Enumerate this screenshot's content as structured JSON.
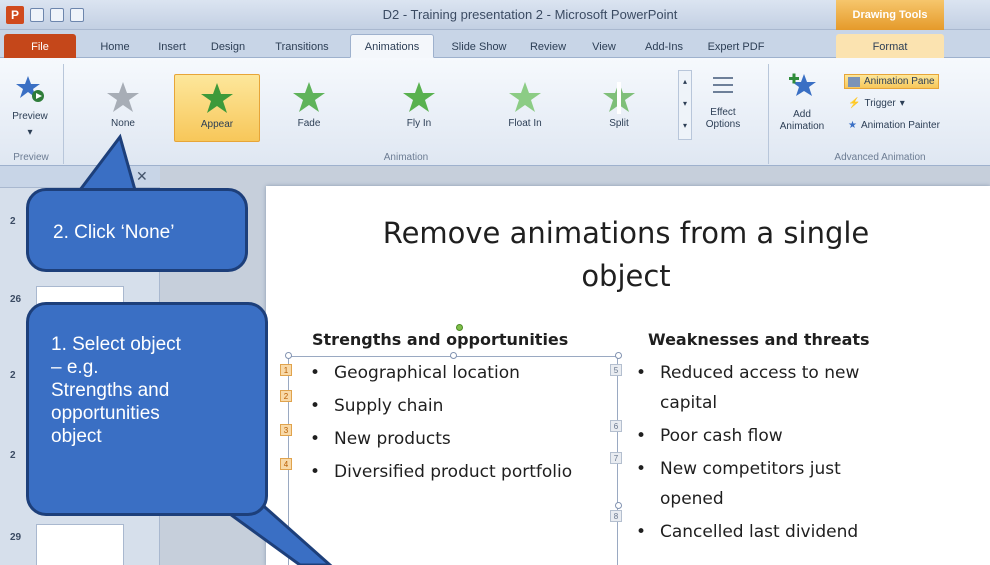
{
  "window": {
    "title": "D2 - Training presentation 2 - Microsoft PowerPoint",
    "contextual_tab": "Drawing Tools"
  },
  "tabs": [
    "File",
    "Home",
    "Insert",
    "Design",
    "Transitions",
    "Animations",
    "Slide Show",
    "Review",
    "View",
    "Add-Ins",
    "Expert PDF",
    "Format"
  ],
  "ribbon": {
    "preview": {
      "label": "Preview",
      "group": "Preview"
    },
    "animation_group": "Animation",
    "gallery": [
      "None",
      "Appear",
      "Fade",
      "Fly In",
      "Float In",
      "Split"
    ],
    "selected": "Appear",
    "effect_options": [
      "Effect",
      "Options"
    ],
    "add_animation": [
      "Add",
      "Animation"
    ],
    "advanced_group": "Advanced Animation",
    "animation_pane": "Animation Pane",
    "trigger": "Trigger",
    "animation_painter": "Animation Painter"
  },
  "slide_numbers": [
    "2",
    "26",
    "2",
    "2",
    "29"
  ],
  "slide": {
    "title_line1": "Remove animations from a single",
    "title_line2": "object",
    "left_heading": "Strengths and opportunities",
    "right_heading": "Weaknesses and threats",
    "left_bullets": [
      "Geographical location",
      "Supply chain",
      "New products",
      "Diversified product portfolio"
    ],
    "right_bullets": [
      "Reduced access to new capital",
      "Poor cash flow",
      "New competitors just opened",
      "Cancelled last dividend"
    ],
    "left_tags": [
      "1",
      "2",
      "3",
      "4"
    ],
    "right_tags": [
      "5",
      "6",
      "7",
      "8"
    ]
  },
  "callouts": {
    "step2": "2. Click ‘None’",
    "step1_lines": [
      "1. Select object",
      "– e.g.",
      "Strengths and",
      "opportunities",
      "object"
    ]
  },
  "colors": {
    "callout_fill": "#3a6fc4",
    "selection": "#f7c75a",
    "file_tab": "#c5471a"
  }
}
